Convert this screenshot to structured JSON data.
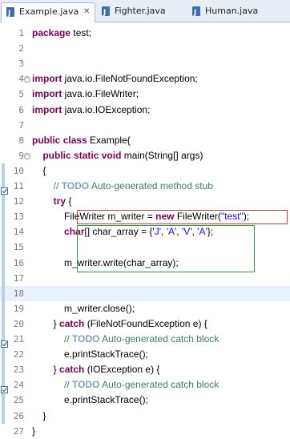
{
  "tabs": [
    {
      "label": "Example.java",
      "active": true,
      "closable": true
    },
    {
      "label": "Fighter.java",
      "active": false
    },
    {
      "label": "Human.java",
      "active": false
    }
  ],
  "lines": [
    {
      "n": "1",
      "parts": [
        {
          "t": "package",
          "c": "kw"
        },
        {
          "t": " test;"
        }
      ]
    },
    {
      "n": "2",
      "parts": []
    },
    {
      "n": "3",
      "parts": []
    },
    {
      "n": "4",
      "parts": [
        {
          "t": "import",
          "c": "kw"
        },
        {
          "t": " java.io.FileNotFoundException;"
        }
      ]
    },
    {
      "n": "5",
      "parts": [
        {
          "t": "import",
          "c": "kw"
        },
        {
          "t": " java.io.FileWriter;"
        }
      ]
    },
    {
      "n": "6",
      "parts": [
        {
          "t": "import",
          "c": "kw"
        },
        {
          "t": " java.io.IOException;"
        }
      ]
    },
    {
      "n": "7",
      "parts": []
    },
    {
      "n": "8",
      "parts": [
        {
          "t": "public",
          "c": "kw"
        },
        {
          "t": " "
        },
        {
          "t": "class",
          "c": "kw"
        },
        {
          "t": " Example{"
        }
      ]
    },
    {
      "n": "9",
      "parts": [
        {
          "t": "    "
        },
        {
          "t": "public",
          "c": "kw"
        },
        {
          "t": " "
        },
        {
          "t": "static",
          "c": "kw"
        },
        {
          "t": " "
        },
        {
          "t": "void",
          "c": "kw"
        },
        {
          "t": " main(String[] args)"
        }
      ]
    },
    {
      "n": "10",
      "parts": [
        {
          "t": "    {"
        }
      ]
    },
    {
      "n": "11",
      "parts": [
        {
          "t": "        "
        },
        {
          "t": "// ",
          "c": "cm"
        },
        {
          "t": "TODO",
          "c": "todo"
        },
        {
          "t": " Auto-generated method stub",
          "c": "cm"
        }
      ]
    },
    {
      "n": "12",
      "parts": [
        {
          "t": "        "
        },
        {
          "t": "try",
          "c": "kw"
        },
        {
          "t": " {"
        }
      ]
    },
    {
      "n": "13",
      "parts": [
        {
          "t": "            FileWriter m_writer = "
        },
        {
          "t": "new",
          "c": "kw"
        },
        {
          "t": " FileWriter("
        },
        {
          "t": "\"test\"",
          "c": "str"
        },
        {
          "t": ");"
        }
      ]
    },
    {
      "n": "14",
      "parts": [
        {
          "t": "            "
        },
        {
          "t": "char",
          "c": "kw"
        },
        {
          "t": "[] char_array = {"
        },
        {
          "t": "'J'",
          "c": "str"
        },
        {
          "t": ", "
        },
        {
          "t": "'A'",
          "c": "str"
        },
        {
          "t": ", "
        },
        {
          "t": "'V'",
          "c": "str"
        },
        {
          "t": ", "
        },
        {
          "t": "'A'",
          "c": "str"
        },
        {
          "t": "};"
        }
      ]
    },
    {
      "n": "15",
      "parts": []
    },
    {
      "n": "16",
      "parts": [
        {
          "t": "            m_writer.write(char_array);"
        }
      ]
    },
    {
      "n": "17",
      "parts": []
    },
    {
      "n": "18",
      "parts": []
    },
    {
      "n": "19",
      "parts": [
        {
          "t": "            m_writer.close();"
        }
      ]
    },
    {
      "n": "20",
      "parts": [
        {
          "t": "        } "
        },
        {
          "t": "catch",
          "c": "kw"
        },
        {
          "t": " (FileNotFoundException e) {"
        }
      ]
    },
    {
      "n": "21",
      "parts": [
        {
          "t": "            "
        },
        {
          "t": "// ",
          "c": "cm"
        },
        {
          "t": "TODO",
          "c": "todo"
        },
        {
          "t": " Auto-generated catch block",
          "c": "cm"
        }
      ]
    },
    {
      "n": "22",
      "parts": [
        {
          "t": "            e.printStackTrace();"
        }
      ]
    },
    {
      "n": "23",
      "parts": [
        {
          "t": "        } "
        },
        {
          "t": "catch",
          "c": "kw"
        },
        {
          "t": " (IOException e) {"
        }
      ]
    },
    {
      "n": "24",
      "parts": [
        {
          "t": "            "
        },
        {
          "t": "// ",
          "c": "cm"
        },
        {
          "t": "TODO",
          "c": "todo"
        },
        {
          "t": " Auto-generated catch block",
          "c": "cm"
        }
      ]
    },
    {
      "n": "25",
      "parts": [
        {
          "t": "            e.printStackTrace();"
        }
      ]
    },
    {
      "n": "26",
      "parts": [
        {
          "t": "    }"
        }
      ]
    },
    {
      "n": "27",
      "parts": [
        {
          "t": "}"
        }
      ]
    }
  ],
  "colors": {
    "keyword": "#7f0055",
    "comment": "#3f7f5f",
    "todo": "#7f9fbf",
    "string": "#2a00ff",
    "current_line": "#e8f2fe",
    "red_box": "#d43a3a",
    "green_box": "#3a9a4a"
  }
}
